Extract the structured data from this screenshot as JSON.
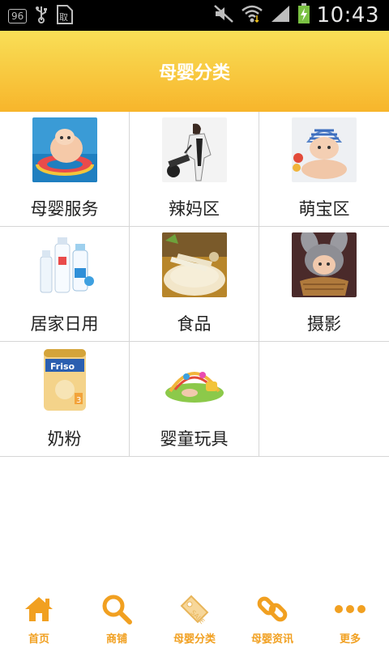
{
  "status_bar": {
    "badge": "96",
    "time": "10:43"
  },
  "header": {
    "title": "母婴分类"
  },
  "categories": [
    {
      "label": "母婴服务"
    },
    {
      "label": "辣妈区"
    },
    {
      "label": "萌宝区"
    },
    {
      "label": "居家日用"
    },
    {
      "label": "食品"
    },
    {
      "label": "摄影"
    },
    {
      "label": "奶粉"
    },
    {
      "label": "婴童玩具"
    }
  ],
  "bottom_nav": [
    {
      "label": "首页",
      "icon": "home-icon"
    },
    {
      "label": "商铺",
      "icon": "search-icon"
    },
    {
      "label": "母婴分类",
      "icon": "tag-icon"
    },
    {
      "label": "母婴资讯",
      "icon": "link-icon"
    },
    {
      "label": "更多",
      "icon": "more-icon"
    }
  ],
  "colors": {
    "accent": "#f1a021",
    "header_top": "#f9df57",
    "header_bottom": "#f7b52b"
  }
}
